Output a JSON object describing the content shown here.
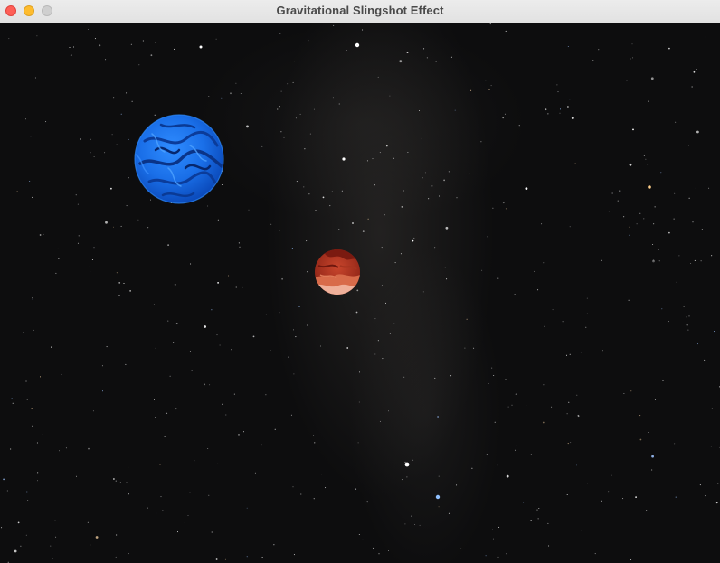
{
  "window": {
    "title": "Gravitational Slingshot Effect"
  },
  "scene": {
    "background": "starfield",
    "bodies": [
      {
        "name": "blue planet",
        "color": "#1a74f0"
      },
      {
        "name": "red planet",
        "color": "#b2311f"
      }
    ]
  },
  "colors": {
    "close": "#fe5f57",
    "minimize": "#febc2e",
    "zoom": "#cfcfcf"
  }
}
